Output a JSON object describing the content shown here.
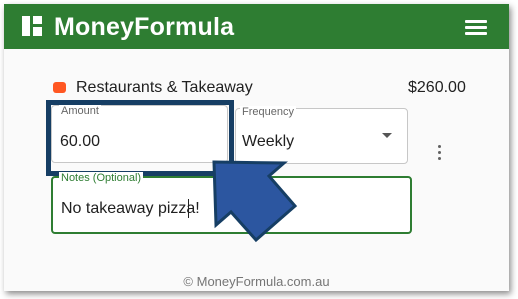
{
  "app": {
    "title": "MoneyFormula",
    "logo_icon": "grid-icon",
    "menu_icon": "hamburger-menu-icon"
  },
  "category": {
    "icon": "category-color-icon",
    "icon_color": "#ff5722",
    "label": "Restaurants & Takeaway",
    "amount": "$260.00"
  },
  "amount_field": {
    "label": "Amount",
    "value": "60.00"
  },
  "frequency_field": {
    "label": "Frequency",
    "value": "Weekly",
    "icon": "dropdown-arrow-icon"
  },
  "more_icon": "more-vertical-icon",
  "notes_field": {
    "label": "Notes (Optional)",
    "value": "No takeaway pizza!"
  },
  "footer": {
    "text": "© MoneyFormula.com.au"
  },
  "colors": {
    "header": "#2e7d32",
    "highlight": "#163e64",
    "pointer": "#2c56a0",
    "accent": "#2e7d32"
  }
}
